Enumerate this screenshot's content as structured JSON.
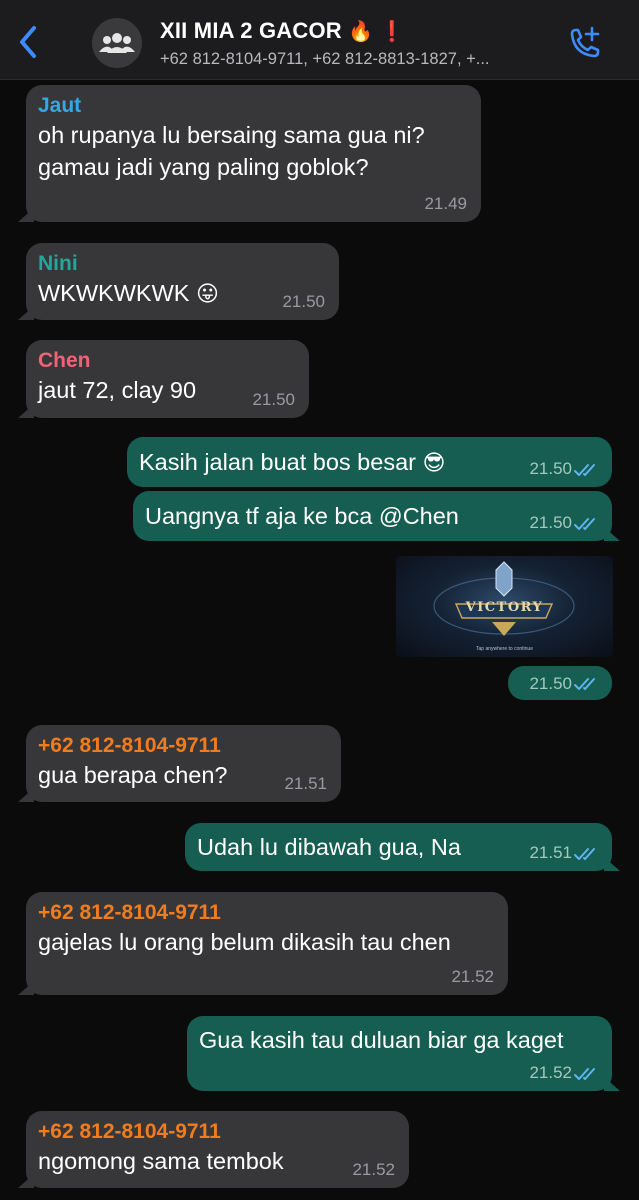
{
  "header": {
    "back_icon": "chevron-left-icon",
    "avatar_icon": "group-icon",
    "title": "XII MIA 2 GACOR",
    "title_emoji_1": "🔥",
    "title_emoji_2": "❗",
    "subtitle": "+62 812-8104-9711, +62 812-8813-1827, +...",
    "call_icon": "add-call-icon"
  },
  "colors": {
    "accent": "#3d8cff",
    "incoming_bubble": "#373739",
    "outgoing_bubble": "#155e51",
    "sender_jaut": "#33a8e6",
    "sender_nini": "#26a69a",
    "sender_chen": "#f06277",
    "sender_phone": "#f07c1e",
    "read_ticks": "#5fb5f2"
  },
  "messages": [
    {
      "dir": "in",
      "sender": "Jaut",
      "lines": [
        "oh rupanya lu bersaing sama gua ni?",
        "gamau jadi yang paling goblok?"
      ],
      "time": "21.49"
    },
    {
      "dir": "in",
      "sender": "Nini",
      "text": "WKWKWKWK",
      "emoji": "😛",
      "time": "21.50"
    },
    {
      "dir": "in",
      "sender": "Chen",
      "text": "jaut 72, clay 90",
      "time": "21.50"
    },
    {
      "dir": "out",
      "text": "Kasih jalan buat bos besar",
      "emoji": "😎",
      "time": "21.50"
    },
    {
      "dir": "out",
      "text": "Uangnya tf aja ke bca @Chen",
      "time": "21.50"
    },
    {
      "dir": "out",
      "image_label": "VICTORY",
      "image_caption": "Tap anywhere to continue",
      "time": "21.50"
    },
    {
      "dir": "in",
      "sender": "+62 812-8104-9711",
      "text": "gua berapa chen?",
      "time": "21.51"
    },
    {
      "dir": "out",
      "text": "Udah lu dibawah gua, Na",
      "time": "21.51"
    },
    {
      "dir": "in",
      "sender": "+62 812-8104-9711",
      "text": "gajelas lu orang belum dikasih tau chen",
      "time": "21.52"
    },
    {
      "dir": "out",
      "text": "Gua kasih tau duluan biar ga kaget",
      "time": "21.52"
    },
    {
      "dir": "in",
      "sender": "+62 812-8104-9711",
      "text": "ngomong sama tembok",
      "time": "21.52"
    }
  ]
}
